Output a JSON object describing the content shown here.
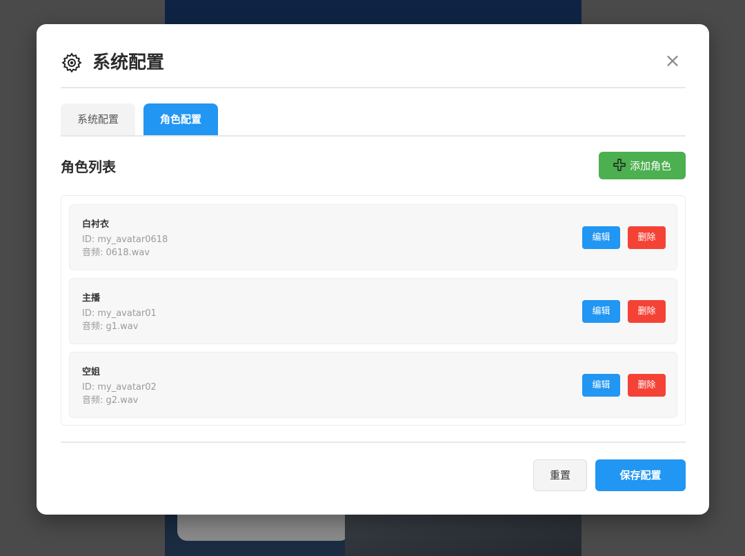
{
  "modal": {
    "title": "系统配置",
    "close_symbol": "×",
    "icon": "gear-icon"
  },
  "tabs": [
    {
      "label": "系统配置",
      "active": false
    },
    {
      "label": "角色配置",
      "active": true
    }
  ],
  "section": {
    "title": "角色列表",
    "add_button_label": "添加角色",
    "add_icon": "plus-icon"
  },
  "roles": [
    {
      "name": "白衬衣",
      "id_text": "ID: my_avatar0618",
      "audio_text": "音频: 0618.wav",
      "edit_label": "编辑",
      "delete_label": "删除"
    },
    {
      "name": "主播",
      "id_text": "ID: my_avatar01",
      "audio_text": "音频: g1.wav",
      "edit_label": "编辑",
      "delete_label": "删除"
    },
    {
      "name": "空姐",
      "id_text": "ID: my_avatar02",
      "audio_text": "音频: g2.wav",
      "edit_label": "编辑",
      "delete_label": "删除"
    }
  ],
  "footer": {
    "reset_label": "重置",
    "save_label": "保存配置"
  },
  "colors": {
    "primary": "#2196f3",
    "success": "#4caf50",
    "danger": "#f44336"
  }
}
